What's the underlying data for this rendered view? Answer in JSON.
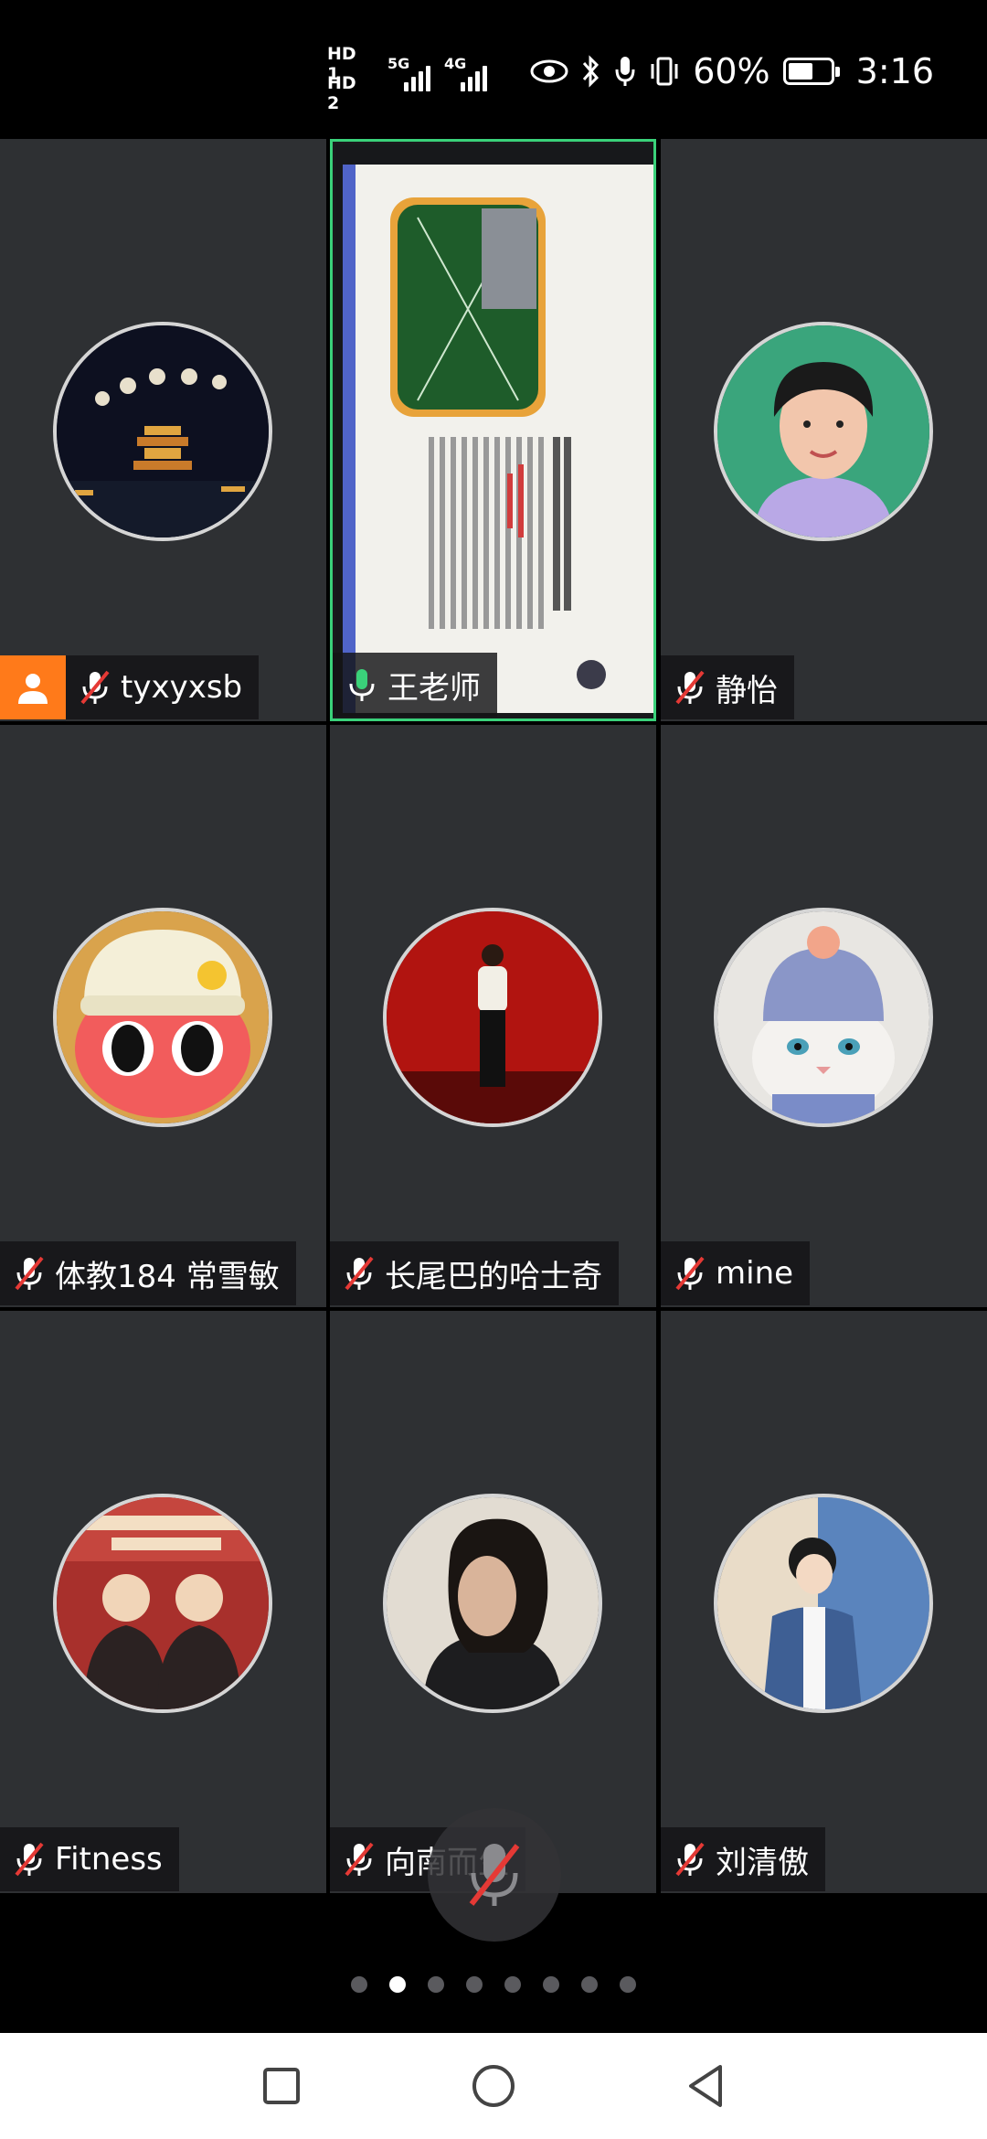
{
  "status_bar": {
    "hd1": "HD 1",
    "hd2": "HD 2",
    "network1": "5G",
    "network2": "4G",
    "battery_text": "60%",
    "battery_level": 0.6,
    "time": "3:16",
    "icons": [
      "eye-icon",
      "bluetooth-icon",
      "mic-icon",
      "vibrate-icon",
      "battery-icon"
    ]
  },
  "participants": [
    {
      "name": "tyxyxsb",
      "muted": true,
      "host": true,
      "avatar": "night-moon-tower"
    },
    {
      "name": "王老师",
      "muted": false,
      "sharing": true
    },
    {
      "name": "静怡",
      "muted": true,
      "avatar": "woman-portrait"
    },
    {
      "name": "体教184 常雪敏",
      "muted": true,
      "avatar": "cartoon-red-face"
    },
    {
      "name": "长尾巴的哈士奇",
      "muted": true,
      "avatar": "person-red-background"
    },
    {
      "name": "mine",
      "muted": true,
      "avatar": "cat-in-hat"
    },
    {
      "name": "Fitness",
      "muted": true,
      "avatar": "poster-two-men"
    },
    {
      "name": "向南而生",
      "muted": true,
      "avatar": "woman-profile"
    },
    {
      "name": "刘清傲",
      "muted": true,
      "avatar": "illustrated-man"
    }
  ],
  "pager": {
    "count": 8,
    "active": 1
  },
  "colors": {
    "tile": "#2e3033",
    "active_border": "#3ad17a",
    "host_badge": "#ff7a1a",
    "muted_red": "#e53935",
    "mic_green": "#3ad17a"
  }
}
